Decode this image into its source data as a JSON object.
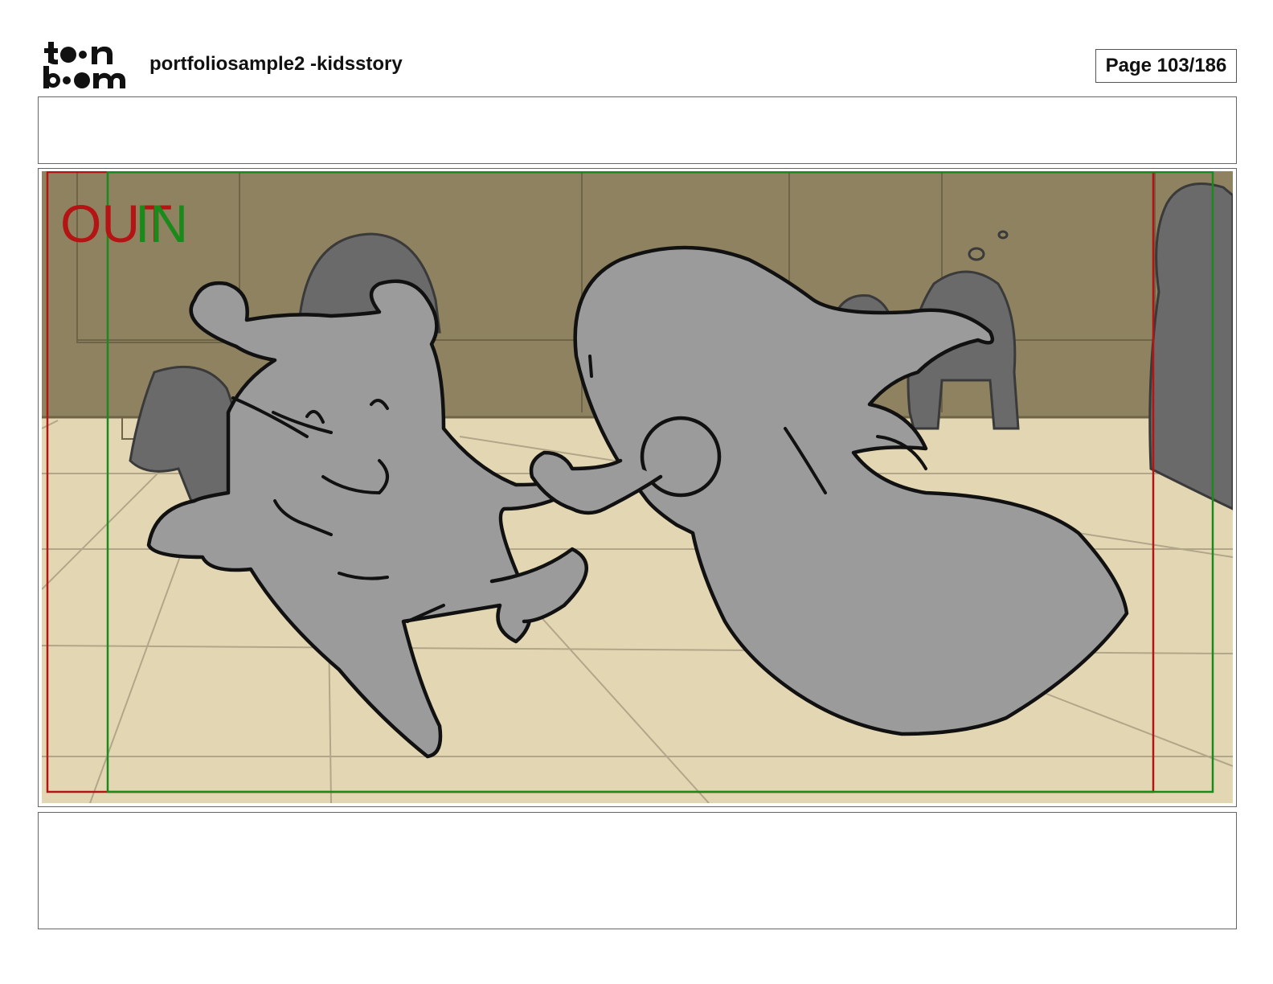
{
  "header": {
    "logo_text": "toon boom",
    "title": "portfoliosample2 -kidsstory",
    "page": "Page 103/186"
  },
  "panel": {
    "out_label": "OUT",
    "in_label": "IN",
    "out_color": "#b41414",
    "in_color": "#1a8a1a",
    "wall_color": "#8f8260",
    "floor_color": "#e3d7b3",
    "figure_color": "#9b9b9b"
  },
  "notes": {
    "top": "",
    "bottom": ""
  }
}
